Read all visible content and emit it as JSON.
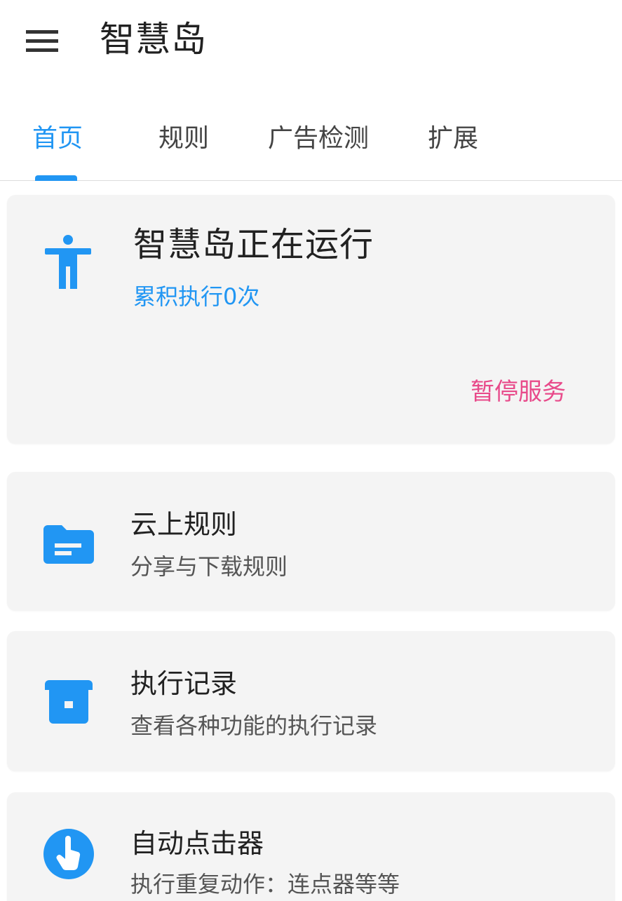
{
  "appbar": {
    "title": "智慧岛",
    "menu_icon": "menu-icon"
  },
  "tabs": [
    {
      "label": "首页",
      "active": true
    },
    {
      "label": "规则",
      "active": false
    },
    {
      "label": "广告检测",
      "active": false
    },
    {
      "label": "扩展",
      "active": false
    }
  ],
  "status": {
    "icon": "accessibility-icon",
    "title": "智慧岛正在运行",
    "count_text": "累积执行0次",
    "pause_label": "暂停服务"
  },
  "items": [
    {
      "icon": "folder-icon",
      "title": "云上规则",
      "subtitle": "分享与下载规则"
    },
    {
      "icon": "archive-icon",
      "title": "执行记录",
      "subtitle": "查看各种功能的执行记录"
    },
    {
      "icon": "touch-icon",
      "title": "自动点击器",
      "subtitle": "执行重复动作：连点器等等"
    }
  ],
  "colors": {
    "accent": "#2196f3",
    "pause": "#e84a8a",
    "card_bg": "#f4f4f4"
  }
}
